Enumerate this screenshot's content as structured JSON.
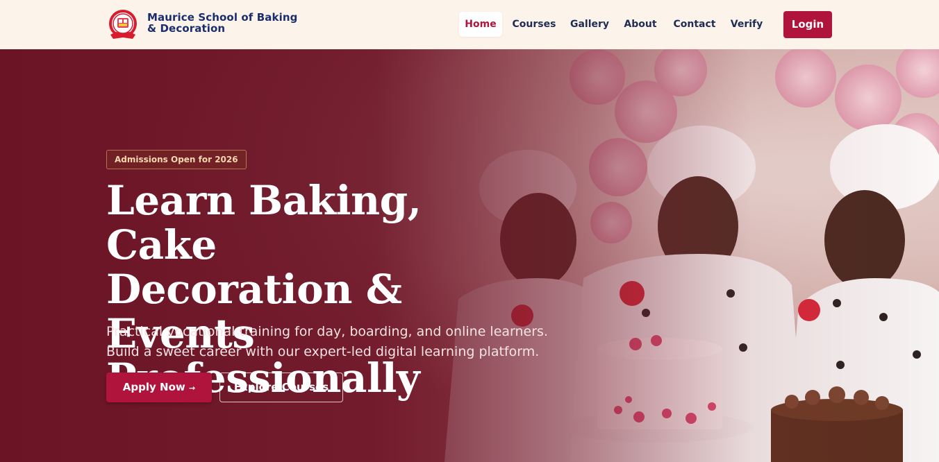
{
  "brand": {
    "name_line1": "Maurice School of Baking",
    "name_line2": "& Decoration",
    "logo_icon": "school-crest-logo"
  },
  "nav": {
    "items": [
      {
        "label": "Home",
        "active": true
      },
      {
        "label": "Courses",
        "active": false
      },
      {
        "label": "Gallery",
        "active": false
      },
      {
        "label": "About",
        "active": false
      },
      {
        "label": "Contact",
        "active": false
      },
      {
        "label": "Verify",
        "active": false
      }
    ],
    "login_label": "Login"
  },
  "hero": {
    "badge": "Admissions Open for 2026",
    "headline_line1": "Learn Baking, Cake",
    "headline_line2": "Decoration & Events",
    "headline_line3": "Professionally",
    "subtext": "Practical vocational training for day, boarding, and online learners. Build a sweet career with our expert-led digital learning platform.",
    "apply_label": "Apply Now",
    "apply_icon": "arrow-right-icon",
    "explore_label": "Explore Courses",
    "image_subject": "three-chefs-decorating-cake-photo"
  },
  "colors": {
    "accent": "#b0143d",
    "brand_text": "#1a2e6e",
    "header_bg": "#fcf3ea",
    "hero_overlay": "#6b1224",
    "badge_text": "#f5d7b0"
  }
}
